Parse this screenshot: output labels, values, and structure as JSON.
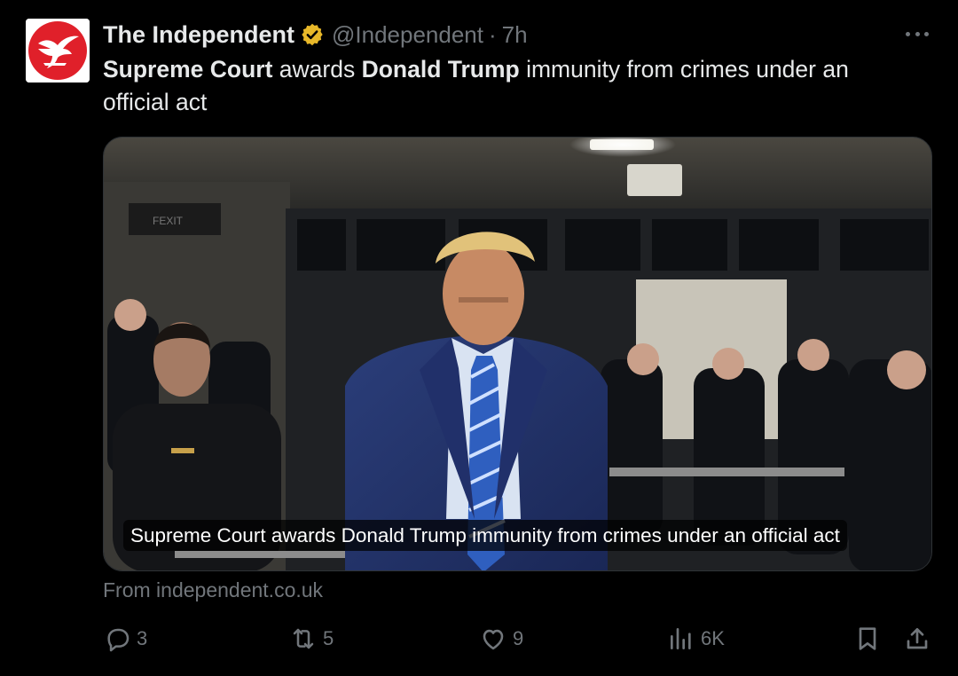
{
  "account": {
    "display_name": "The Independent",
    "handle": "@Independent",
    "separator": "·",
    "time": "7h",
    "avatar_icon": "independent-eagle-logo",
    "verified_color": "#e8b829"
  },
  "tweet": {
    "segments": [
      {
        "text": "Supreme Court",
        "bold": true
      },
      {
        "text": " awards ",
        "bold": false
      },
      {
        "text": "Donald Trump",
        "bold": true
      },
      {
        "text": " immunity from crimes under an official act",
        "bold": false
      }
    ]
  },
  "card": {
    "caption": "Supreme Court awards Donald Trump immunity from crimes under an official act",
    "source": "From independent.co.uk",
    "image_description_icon": "news-photo"
  },
  "actions": {
    "reply_count": "3",
    "retweet_count": "5",
    "like_count": "9",
    "views_count": "6K"
  },
  "colors": {
    "background": "#000000",
    "text": "#e7e9ea",
    "muted": "#71767b",
    "brand_red": "#e0202a"
  }
}
